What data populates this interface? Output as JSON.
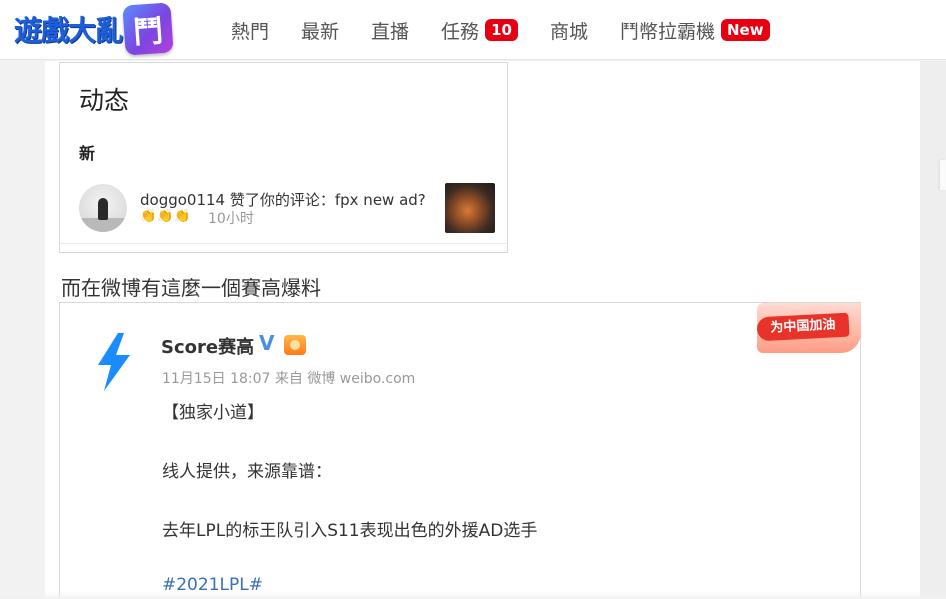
{
  "header": {
    "logo_text": "遊戲大亂",
    "logo_badge_char": "鬥",
    "nav": [
      {
        "label": "熱門",
        "badge": null
      },
      {
        "label": "最新",
        "badge": null
      },
      {
        "label": "直播",
        "badge": null
      },
      {
        "label": "任務",
        "badge": "10"
      },
      {
        "label": "商城",
        "badge": null
      },
      {
        "label": "鬥幣拉霸機",
        "badge": "New"
      }
    ],
    "colors": {
      "logo_blue": "#1e5fd8",
      "badge_red": "#e60012"
    }
  },
  "shot1": {
    "title": "动态",
    "subtitle": "新",
    "notification_line": "doggo0114 赞了你的评论：fpx new ad?",
    "emojis": "👏👏👏",
    "time": "10小时"
  },
  "caption": "而在微博有這麼一個賽高爆料",
  "weibo": {
    "name": "Score赛高",
    "verified_mark": "V",
    "meta": "11月15日 18:07 来自 微博 weibo.com",
    "banner": "为中国加油",
    "lines": [
      "【独家小道】",
      "线人提供，来源靠谱：",
      "去年LPL的标王队引入S11表现出色的外援AD选手"
    ],
    "hashtag": "#2021LPL#",
    "colors": {
      "bolt": "#1a8cff",
      "hashtag": "#3a6fb5"
    }
  }
}
